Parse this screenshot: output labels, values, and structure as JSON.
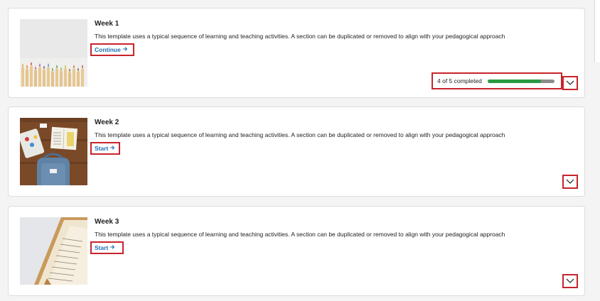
{
  "weeks": [
    {
      "title": "Week 1",
      "description": "This template uses a typical sequence of learning and teaching activities. A section can be duplicated or removed to align with your pedagogical approach",
      "action_label": "Continue",
      "image": "colored-pencils-photo",
      "progress": {
        "text": "4 of 5 completed",
        "completed": 4,
        "total": 5
      }
    },
    {
      "title": "Week 2",
      "description": "This template uses a typical sequence of learning and teaching activities. A section can be duplicated or removed to align with your pedagogical approach",
      "action_label": "Start",
      "image": "desk-backpack-photo"
    },
    {
      "title": "Week 3",
      "description": "This template uses a typical sequence of learning and teaching activities. A section can be duplicated or removed to align with your pedagogical approach",
      "action_label": "Start",
      "image": "open-book-photo"
    }
  ],
  "colors": {
    "link": "#1f6fb2",
    "highlight_border": "#c8242c",
    "progress_fill": "#2a9a42",
    "progress_track": "#8c8c8c"
  },
  "icons": {
    "action_arrow": "arrow-right-icon",
    "expand": "chevron-down-icon"
  }
}
